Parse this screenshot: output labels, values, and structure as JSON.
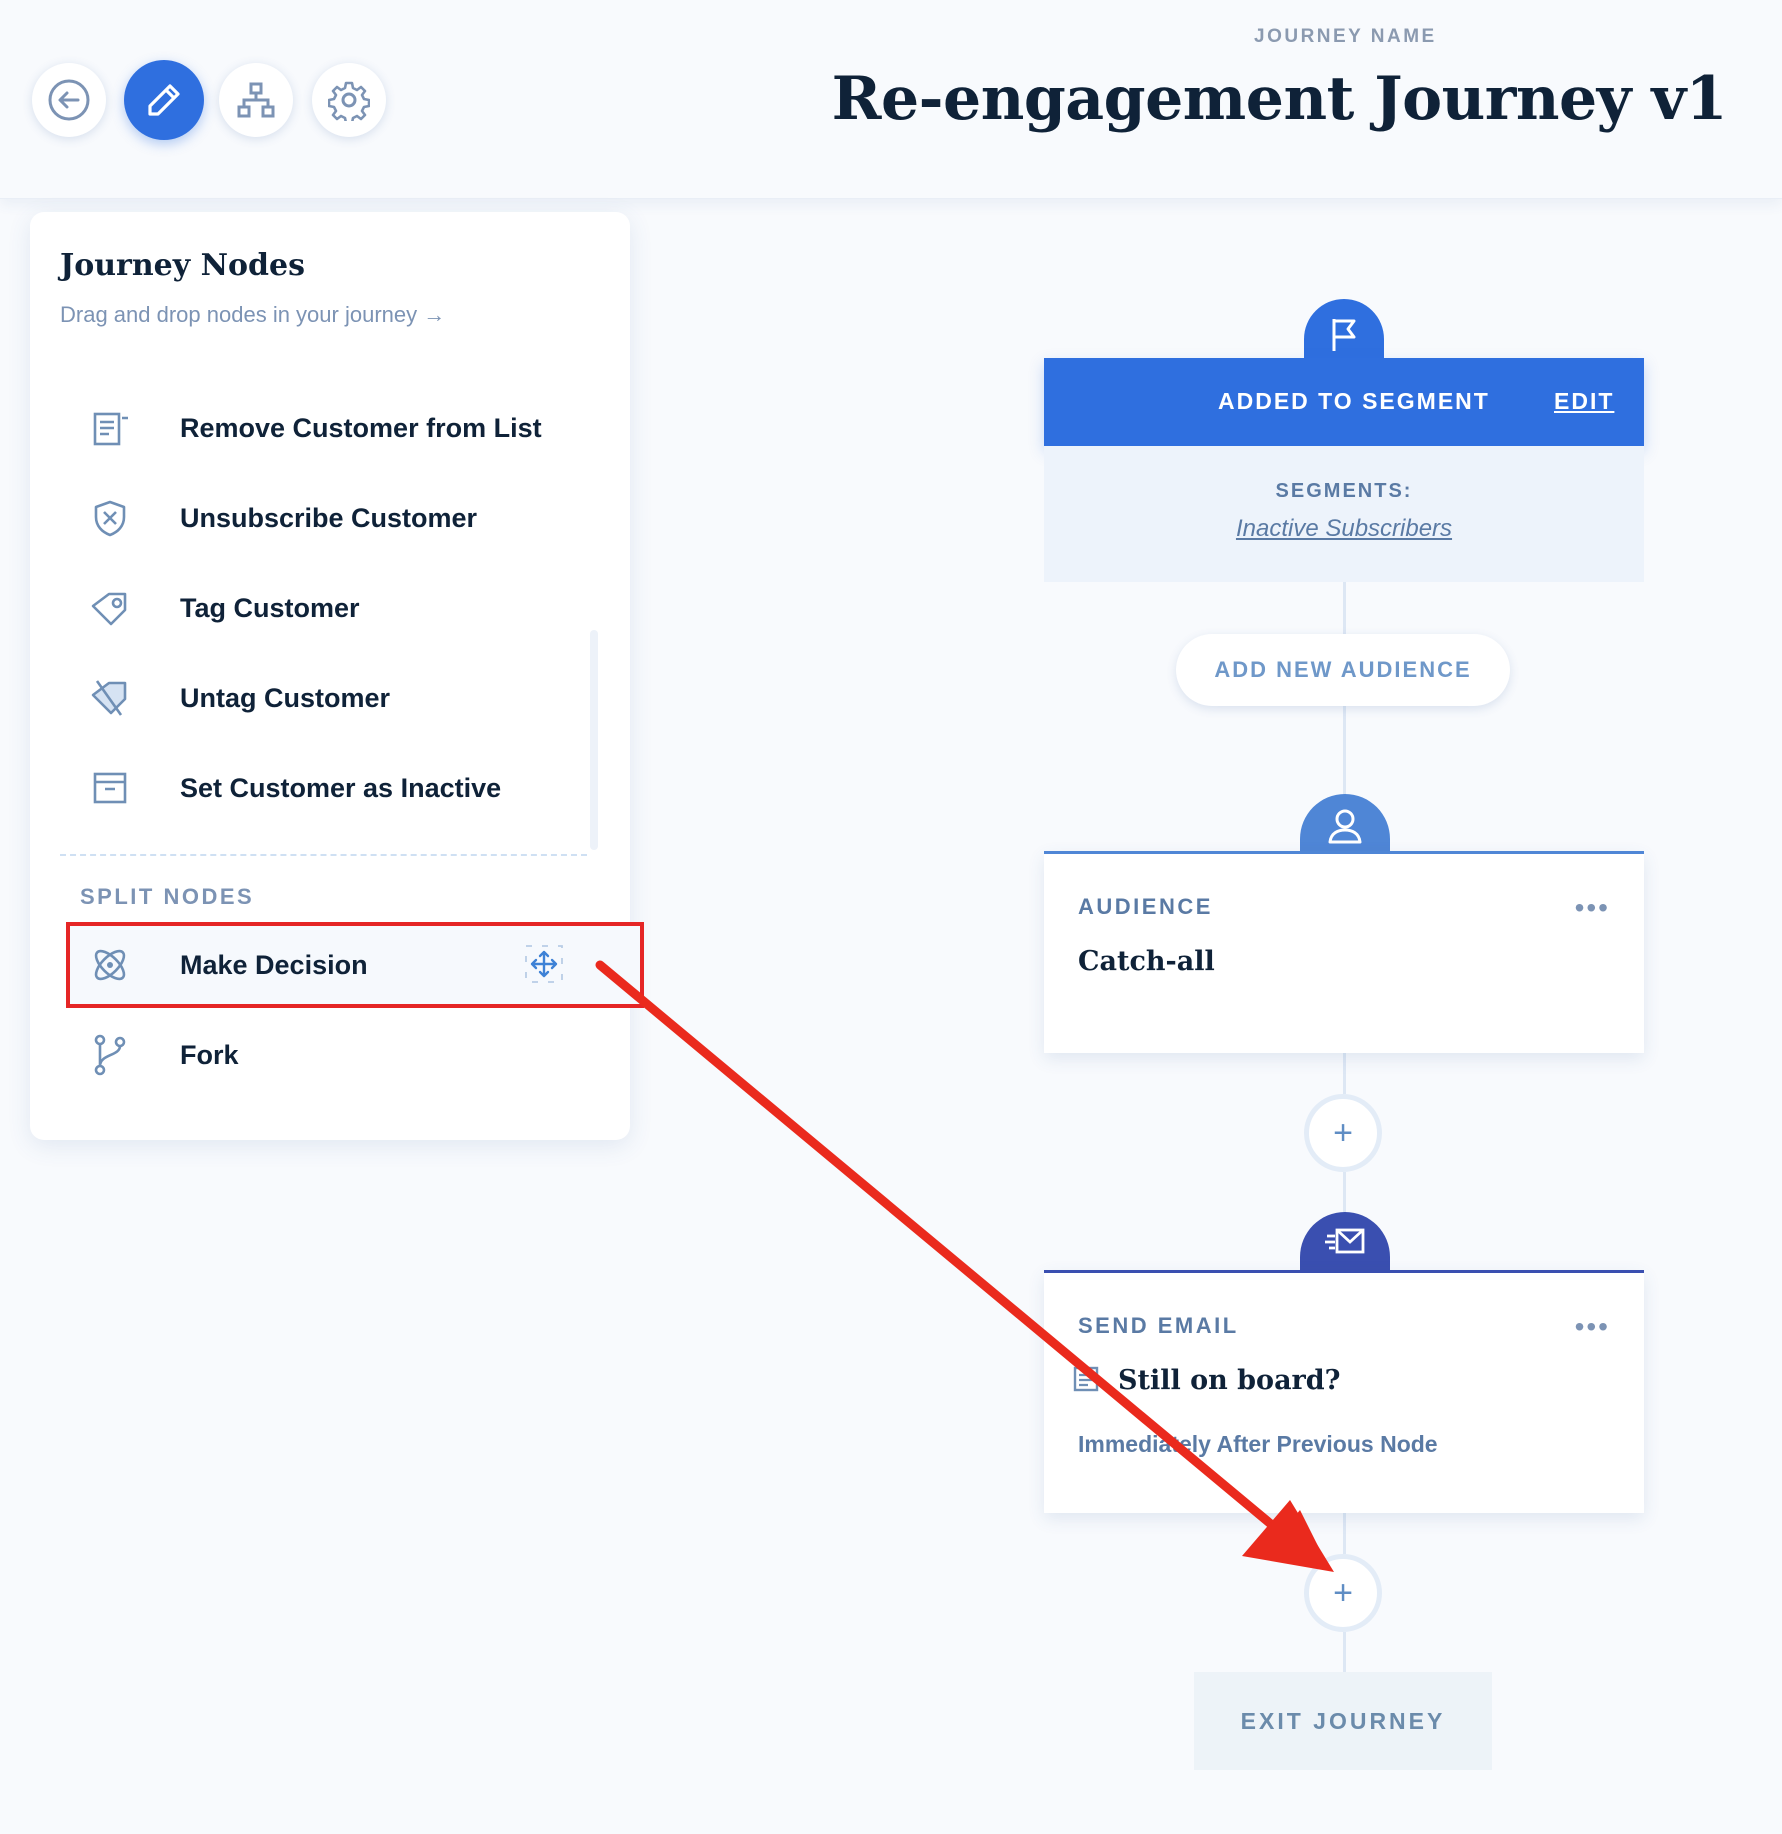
{
  "toolbar": {
    "buttons": [
      {
        "icon": "back-arrow-icon"
      },
      {
        "icon": "pencil-icon",
        "active": true
      },
      {
        "icon": "hierarchy-icon"
      },
      {
        "icon": "gear-icon"
      }
    ]
  },
  "header": {
    "label": "JOURNEY NAME",
    "title": "Re-engagement Journey v1"
  },
  "sidebar": {
    "title": "Journey Nodes",
    "subtitle": "Drag and drop nodes in your journey →",
    "items": [
      {
        "label": "Remove Customer from List",
        "icon": "list-remove-icon"
      },
      {
        "label": "Unsubscribe Customer",
        "icon": "shield-x-icon"
      },
      {
        "label": "Tag Customer",
        "icon": "tag-icon"
      },
      {
        "label": "Untag Customer",
        "icon": "tag-off-icon"
      },
      {
        "label": "Set Customer as Inactive",
        "icon": "archive-icon"
      }
    ],
    "split_section": {
      "label": "SPLIT NODES",
      "items": [
        {
          "label": "Make Decision",
          "icon": "atom-icon",
          "highlighted": true
        },
        {
          "label": "Fork",
          "icon": "branch-icon"
        }
      ]
    }
  },
  "flow": {
    "trigger": {
      "title": "ADDED TO SEGMENT",
      "edit_label": "EDIT",
      "segments_label": "SEGMENTS:",
      "segments_value": "Inactive Subscribers"
    },
    "add_audience_label": "ADD NEW AUDIENCE",
    "audience": {
      "title": "AUDIENCE",
      "value": "Catch-all",
      "menu": "•••"
    },
    "plus": "+",
    "send_email": {
      "title": "SEND EMAIL",
      "subject": "Still on board?",
      "timing": "Immediately After Previous Node",
      "menu": "•••"
    },
    "exit_label": "EXIT JOURNEY"
  },
  "colors": {
    "accent": "#2f6fdf",
    "email_node": "#3a4fb0",
    "audience_node": "#4f86d6",
    "annotation_red": "#e52626"
  }
}
